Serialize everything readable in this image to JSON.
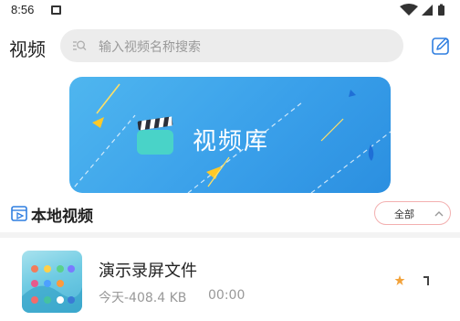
{
  "status_bar": {
    "time": "8:56"
  },
  "header": {
    "title": "视频",
    "search_placeholder": "输入视频名称搜索"
  },
  "banner": {
    "title": "视频库"
  },
  "section": {
    "title": "本地视频",
    "filter_label": "全部"
  },
  "videos": [
    {
      "title": "演示录屏文件",
      "meta": "今天-408.4 KB",
      "duration": "00:00"
    }
  ],
  "colors": {
    "banner": "#3aa0ea",
    "accent": "#2f7ee0",
    "filter_border": "#f3b0b0",
    "clapper": "#49d3c8"
  }
}
